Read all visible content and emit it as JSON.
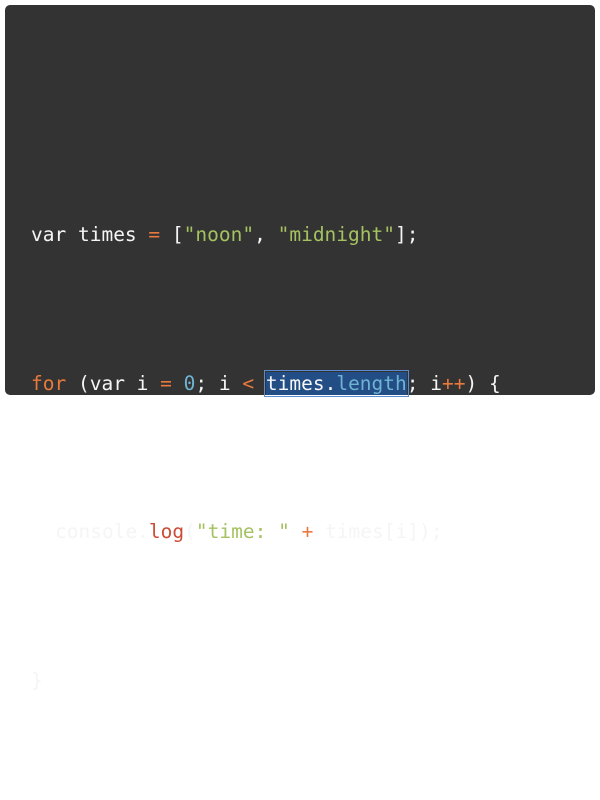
{
  "colors": {
    "background": "#333333",
    "default_text": "#f5f5f5",
    "operator": "#e9793c",
    "string": "#a5c261",
    "number": "#6fb3d2",
    "property": "#6fb3d2",
    "function": "#cc4b35",
    "selection": "#224d85"
  },
  "code": {
    "line1": {
      "var_kw": "var",
      "name": " times ",
      "eq": "=",
      "open": " [",
      "s1": "\"noon\"",
      "comma": ", ",
      "s2": "\"midnight\"",
      "close": "];"
    },
    "line2": {
      "for_kw": "for",
      "open": " (var i ",
      "eq": "=",
      "sp": " ",
      "zero": "0",
      "mid": "; i ",
      "lt": "<",
      "sp2": " ",
      "sel_obj": "times.",
      "sel_prop": "length",
      "semi": "; i",
      "inc": "++",
      "close": ") {"
    },
    "line3": {
      "obj": "console.",
      "fn": "log",
      "open": "(",
      "str": "\"time: \"",
      "sp": " ",
      "plus": "+",
      "rest": " times[i]);"
    },
    "line4": {
      "brace": "}"
    }
  }
}
